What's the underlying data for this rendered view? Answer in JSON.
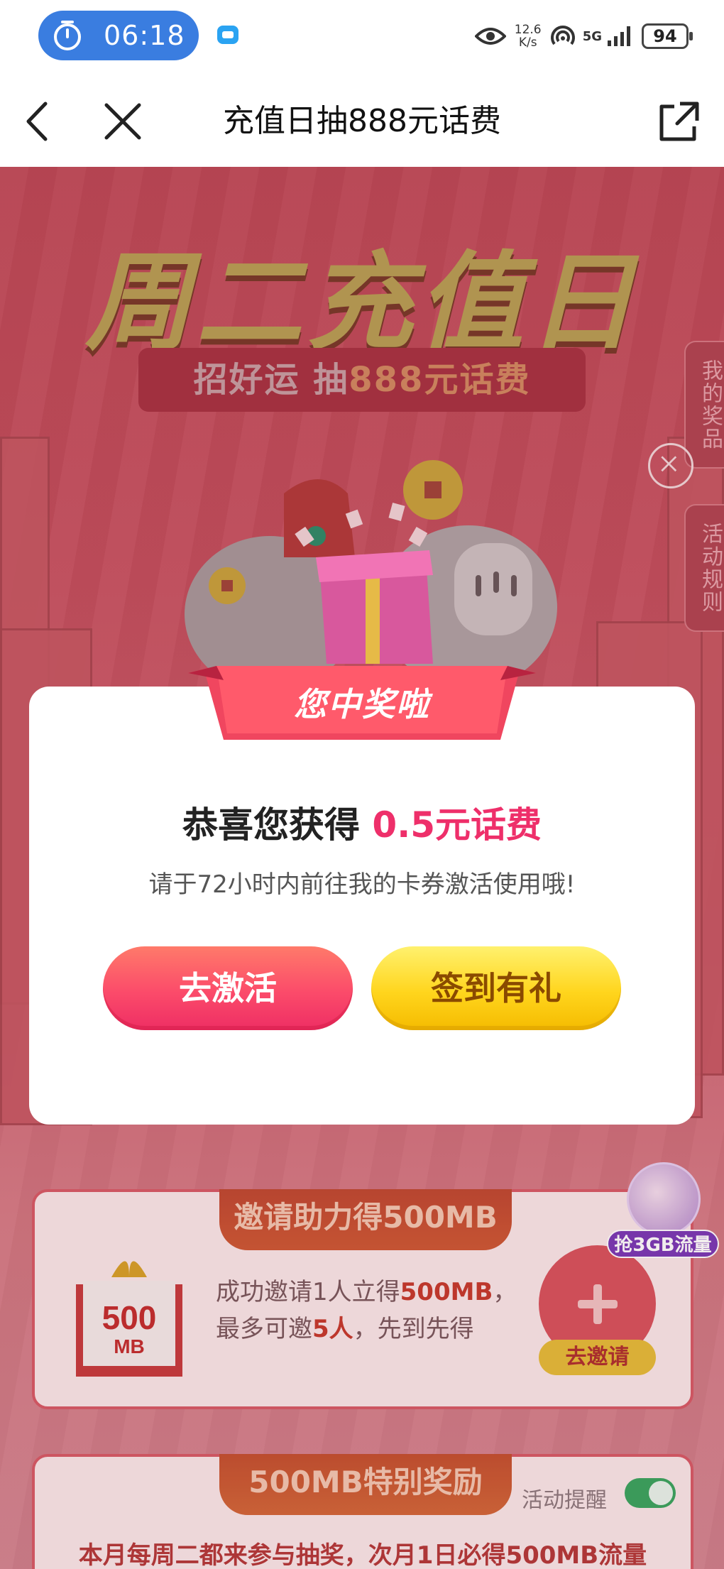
{
  "status_bar": {
    "time": "06:18",
    "net_speed_value": "12.6",
    "net_speed_unit": "K/s",
    "signal_label": "5G",
    "battery": "94"
  },
  "nav": {
    "title": "充值日抽888元话费"
  },
  "hero": {
    "title": "周二充值日",
    "subtitle_prefix": "招好运 抽",
    "subtitle_highlight": "888元话费"
  },
  "side_tabs": {
    "my_prizes": "我的奖品",
    "rules": "活动规则"
  },
  "modal": {
    "ribbon": "您中奖啦",
    "congrats_prefix": "恭喜您获得 ",
    "prize": "0.5元话费",
    "hint": "请于72小时内前往我的卡券激活使用哦!",
    "activate_button": "去激活",
    "checkin_button": "签到有礼"
  },
  "invite_card": {
    "header": "邀请助力得500MB",
    "gift_amount": "500",
    "gift_unit": "MB",
    "line1_prefix": "成功邀请1人立得",
    "line1_highlight": "500MB",
    "line1_suffix": "，",
    "line2_prefix": "最多可邀",
    "line2_highlight": "5人",
    "line2_suffix": "，先到先得",
    "invite_button": "去邀请"
  },
  "floating_badge": {
    "label": "抢3GB流量"
  },
  "bonus_card": {
    "header": "500MB特别奖励",
    "reminder_label": "活动提醒",
    "reminder_on": true,
    "note": "本月每周二都来参与抽奖，次月1日必得500MB流量"
  },
  "colors": {
    "accent_pink": "#ee2f6a",
    "button_red": "#fb4b6a",
    "button_yellow": "#ffd51d",
    "status_pill_blue": "#3a7de0",
    "toggle_green": "#3aa760"
  }
}
